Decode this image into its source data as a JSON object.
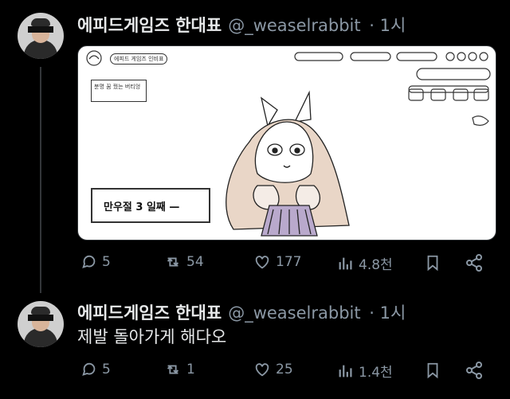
{
  "tweet1": {
    "name": "에피드게임즈 한대표",
    "handle": "@_weaselrabbit",
    "time": "· 1시",
    "media": {
      "caption": "만우절 3 일째 —",
      "label_top": "에피드 게임즈 인비표",
      "label_left": "분명 꿈 꿨는 버티엉"
    },
    "actions": {
      "replies": "5",
      "retweets": "54",
      "likes": "177",
      "views": "4.8천"
    }
  },
  "tweet2": {
    "name": "에피드게임즈 한대표",
    "handle": "@_weaselrabbit",
    "time": "· 1시",
    "text": "제발 돌아가게 해다오",
    "actions": {
      "replies": "5",
      "retweets": "1",
      "likes": "25",
      "views": "1.4천"
    }
  },
  "icons": [
    "reply-icon",
    "retweet-icon",
    "like-icon",
    "views-icon",
    "bookmark-icon",
    "share-icon"
  ]
}
